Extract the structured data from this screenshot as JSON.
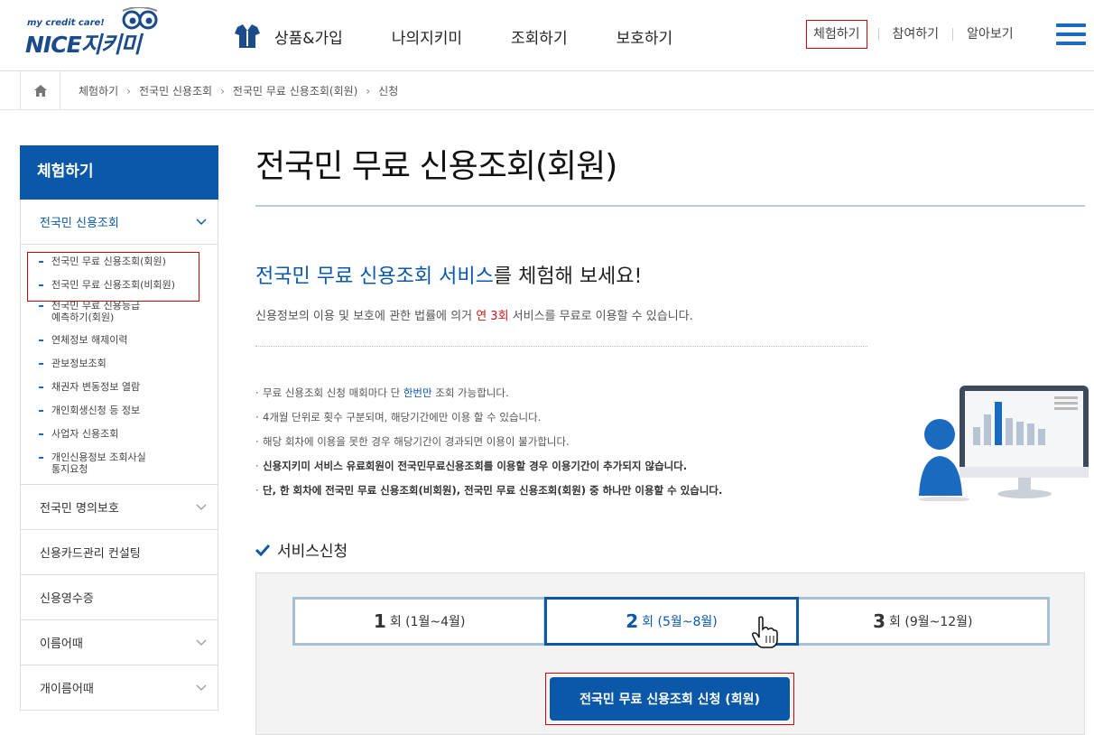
{
  "header": {
    "logo_tag": "my credit care!",
    "logo_brand": "NICE지키미",
    "gnb": [
      "상품&가입",
      "나의지키미",
      "조회하기",
      "보호하기"
    ],
    "util": [
      "체험하기",
      "참여하기",
      "알아보기"
    ]
  },
  "breadcrumb": [
    "체험하기",
    "전국민 신용조회",
    "전국민 무료 신용조회(회원)",
    "신청"
  ],
  "lnb": {
    "head": "체험하기",
    "open_menu": "전국민 신용조회",
    "subs": [
      "전국민 무료 신용조회(회원)",
      "전국민 무료 신용조회(비회원)",
      "전국민 무료 신용등급",
      "예측하기(회원)",
      "연체정보 해제이력",
      "관보정보조회",
      "채권자 변동정보 열람",
      "개인회생신청 등 정보",
      "사업자 신용조회",
      "개인신용정보 조회사실",
      "통지요청"
    ],
    "menus": [
      "전국민 명의보호",
      "신용카드관리 컨설팅",
      "신용영수증",
      "이름어때",
      "개이름어때"
    ]
  },
  "main": {
    "title": "전국민 무료 신용조회(회원)",
    "sub_blue": "전국민 무료 신용조회 서비스",
    "sub_rest": "를 체험해 보세요!",
    "desc_pre": "신용정보의 이용 및 보호에 관한 법률에 의거 ",
    "desc_red": "연 3회",
    "desc_post": " 서비스를 무료로 이용할 수 있습니다.",
    "notes": [
      {
        "pre": "무료 신용조회 신청 매회마다 단 ",
        "blue": "한번만",
        "post": " 조회 가능합니다."
      },
      {
        "pre": "4개월 단위로 횟수 구분되며, 해당기간에만 이용 할 수 있습니다."
      },
      {
        "pre": "해당 회차에 이용을 못한 경우 해당기간이 경과되면 이용이 불가합니다."
      },
      {
        "bold": "신용지키미 서비스 유료회원이 전국민무료신용조회를 이용할 경우 이용기간이 추가되지 않습니다."
      },
      {
        "bold": "단, 한 회차에 전국민 무료 신용조회(비회원), 전국민 무료 신용조회(회원) 중 하나만 이용할 수 있습니다."
      }
    ],
    "service_heading": "서비스신청",
    "tabs": [
      {
        "num": "1",
        "unit": "회",
        "period": "(1월~4월)"
      },
      {
        "num": "2",
        "unit": "회",
        "period": "(5월~8월)"
      },
      {
        "num": "3",
        "unit": "회",
        "period": "(9월~12월)"
      }
    ],
    "apply_button": "전국민 무료 신용조회 신청 (회원)"
  },
  "colors": {
    "brand_blue": "#0b58a8",
    "highlight_red": "#d60000"
  }
}
